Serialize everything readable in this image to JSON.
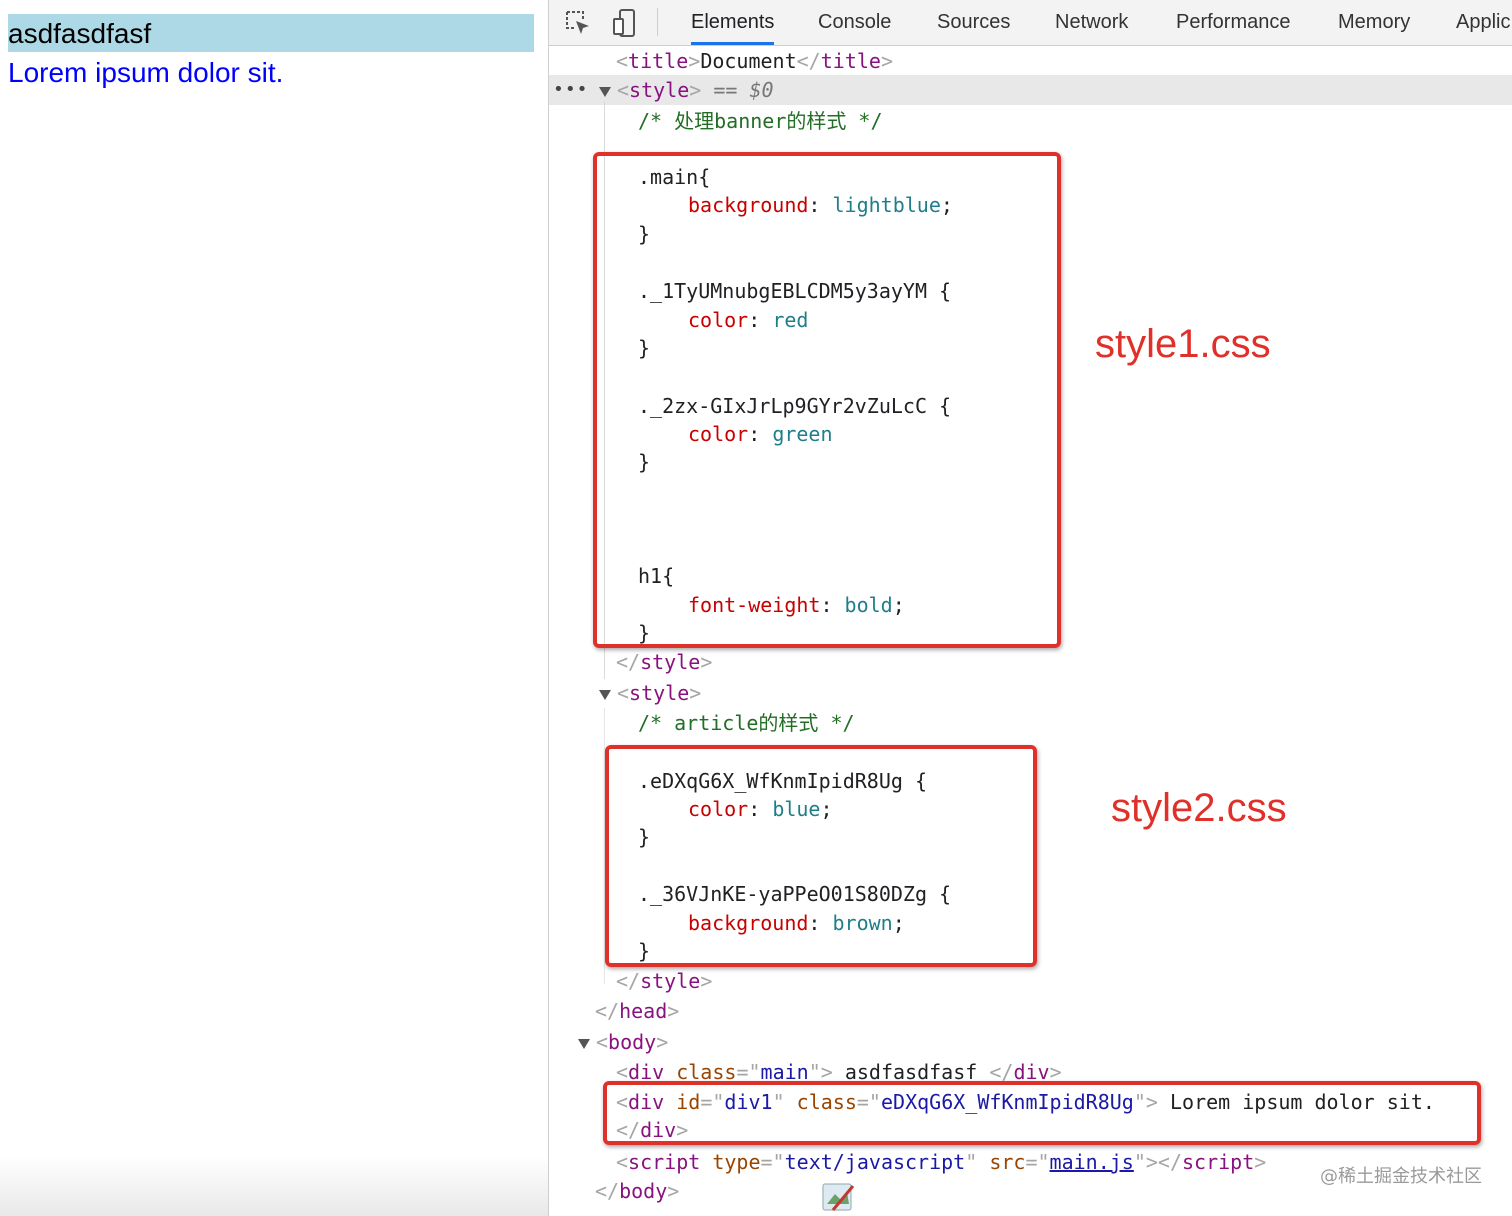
{
  "preview": {
    "main_text": "asdfasdfasf",
    "div1_text": "Lorem ipsum dolor sit."
  },
  "devtools": {
    "tabs": [
      "Elements",
      "Console",
      "Sources",
      "Network",
      "Performance",
      "Memory",
      "Applic"
    ],
    "active_tab": "Elements",
    "icons": [
      "inspect-element-icon",
      "device-toolbar-icon"
    ]
  },
  "code": {
    "title_open": "title",
    "title_text": "Document",
    "style": "style",
    "eq": "== $0",
    "comment1": "/* 处理banner的样式 */",
    "sel_main": ".main{",
    "prop_background": "background",
    "val_lightblue": "lightblue",
    "close": "}",
    "sel_1": "._1TyUMnubgEBLCDM5y3ayYM {",
    "prop_color": "color",
    "val_red": "red",
    "sel_2": "._2zx-GIxJrLp9GYr2vZuLcC {",
    "val_green": "green",
    "sel_h1": "h1{",
    "prop_font_weight": "font-weight",
    "val_bold": "bold",
    "comment2": "/* article的样式 */",
    "sel_3": ".eDXqG6X_WfKnmIpidR8Ug {",
    "val_blue": "blue",
    "sel_4": "._36VJnKE-yaPPeO01S80DZg {",
    "val_brown": "brown",
    "head": "head",
    "body": "body",
    "div": "div",
    "attr_class": "class",
    "attr_id": "id",
    "val_main": "main",
    "text_main": " asdfasdfasf ",
    "val_div1": "div1",
    "val_class2": "eDXqG6X_WfKnmIpidR8Ug",
    "text_div1": " Lorem ipsum dolor sit.",
    "script": "script",
    "attr_type": "type",
    "val_type": "text/javascript",
    "attr_src": "src",
    "val_src": "main.js"
  },
  "annotations": {
    "style1": "style1.css",
    "style2": "style2.css",
    "watermark": "@稀土掘金技术社区",
    "color": "#e0302a"
  }
}
